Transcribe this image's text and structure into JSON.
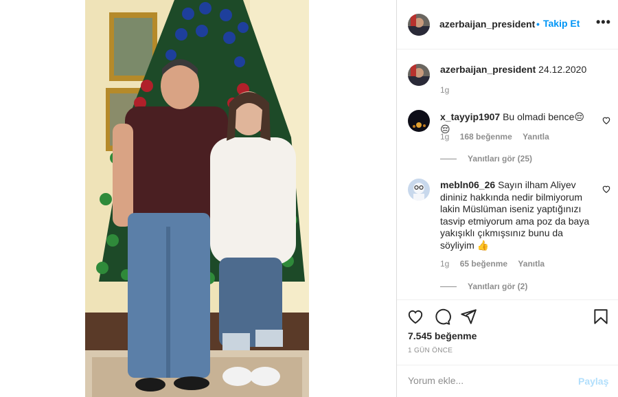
{
  "post": {
    "author": "azerbaijan_president",
    "follow_dot": "•",
    "follow_label": "Takip Et",
    "more_label": "•••"
  },
  "caption": {
    "author": "azerbaijan_president",
    "text": "24.12.2020",
    "age": "1g"
  },
  "comments": [
    {
      "author": "x_tayyip1907",
      "text": "Bu olmadi bence😔😔",
      "age": "1g",
      "likes": "168 beğenme",
      "reply_label": "Yanıtla",
      "view_replies": "Yanıtları gör (25)"
    },
    {
      "author": "mebln06_26",
      "text": "Sayın ilham Aliyev dininiz hakkında nedir bilmiyorum lakin Müslüman iseniz yaptığınızı tasvip etmiyorum ama poz da baya yakışıklı çıkmışsınız bunu da söyliyim 👍",
      "age": "1g",
      "likes": "65 beğenme",
      "reply_label": "Yanıtla",
      "view_replies": "Yanıtları gör (2)"
    }
  ],
  "actions": {
    "icons": [
      "heart-icon",
      "comment-icon",
      "share-icon",
      "bookmark-icon"
    ],
    "likes": "7.545 beğenme",
    "time_ago": "1 GÜN ÖNCE"
  },
  "add_comment": {
    "placeholder": "Yorum ekle...",
    "post_label": "Paylaş"
  },
  "colors": {
    "accent": "#0095f6",
    "accent_disabled": "#b2dffc",
    "muted": "#8e8e8e",
    "text": "#262626",
    "border": "#dbdbdb"
  }
}
